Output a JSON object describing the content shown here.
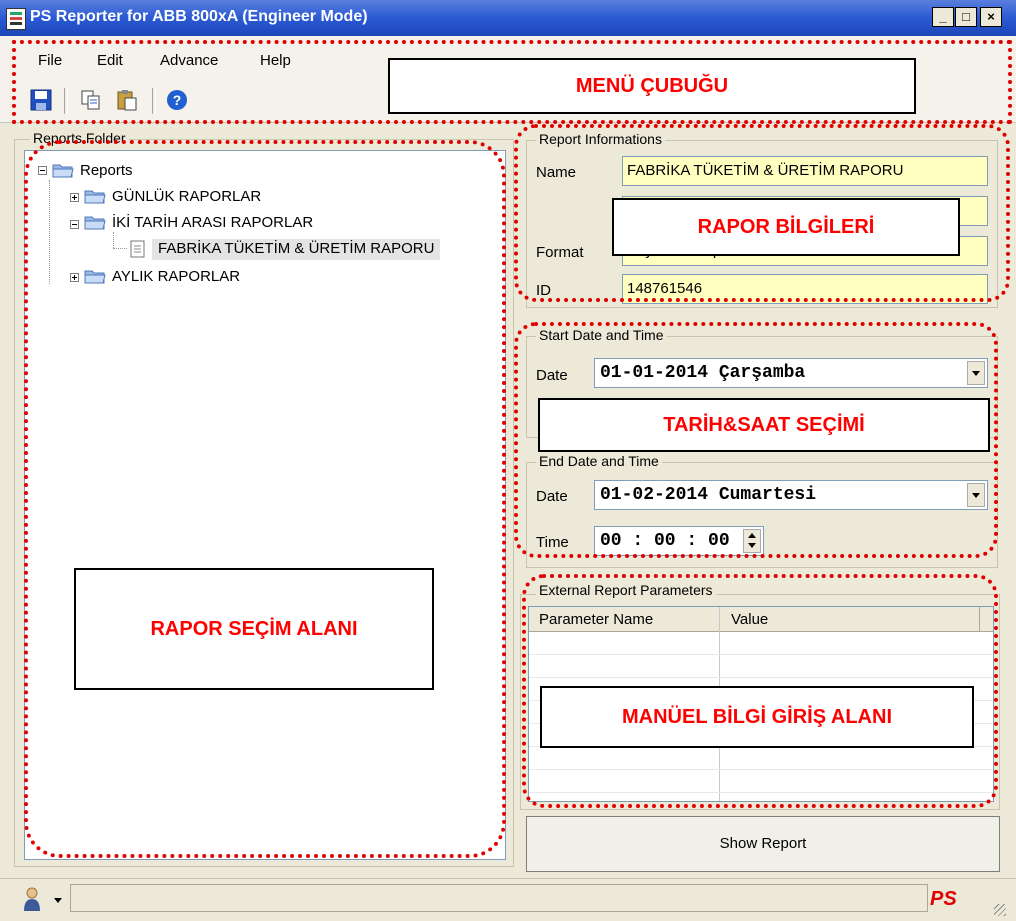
{
  "window": {
    "title": "PS Reporter for ABB 800xA (Engineer Mode)",
    "controls": [
      "_",
      "□",
      "×"
    ]
  },
  "menu": [
    "File",
    "Edit",
    "Advance",
    "Help"
  ],
  "toolbar_icons": [
    "save-icon",
    "copy-icon",
    "paste-icon",
    "help-icon"
  ],
  "reports_folder": {
    "label": "Reports Folder",
    "root": "Reports",
    "items": [
      "GÜNLÜK RAPORLAR",
      "İKİ TARİH ARASI RAPORLAR",
      "FABRİKA TÜKETİM & ÜRETİM RAPORU",
      "AYLIK RAPORLAR"
    ]
  },
  "report_info": {
    "label": "Report Informations",
    "name_label": "Name",
    "name_value": "FABRİKA TÜKETİM & ÜRETİM RAPORU",
    "format_label": "Format",
    "format_value": "Any Time Report",
    "id_label": "ID",
    "id_value": "148761546"
  },
  "start": {
    "label": "Start Date and Time",
    "date_label": "Date",
    "date_value": "01-01-2014 Çarşamba"
  },
  "end": {
    "label": "End Date and Time",
    "date_label": "Date",
    "date_value": "01-02-2014 Cumartesi",
    "time_label": "Time",
    "time_value": "00 : 00 : 00"
  },
  "external": {
    "label": "External Report Parameters",
    "col1": "Parameter Name",
    "col2": "Value"
  },
  "show_report": "Show Report",
  "status_logo": "PS",
  "callouts": {
    "menu": "MENÜ   ÇUBUĞU",
    "rapor_bilgileri": "RAPOR BİLGİLERİ",
    "tarih_saat": "TARİH&SAAT SEÇİMİ",
    "rapor_secim": "RAPOR SEÇİM ALANI",
    "manuel": "MANÜEL BİLGİ GİRİŞ ALANI"
  },
  "colors": {
    "titlebar": "#2a5ad4",
    "highlight_field": "#ffffc0",
    "annotation": "#ff0000"
  }
}
